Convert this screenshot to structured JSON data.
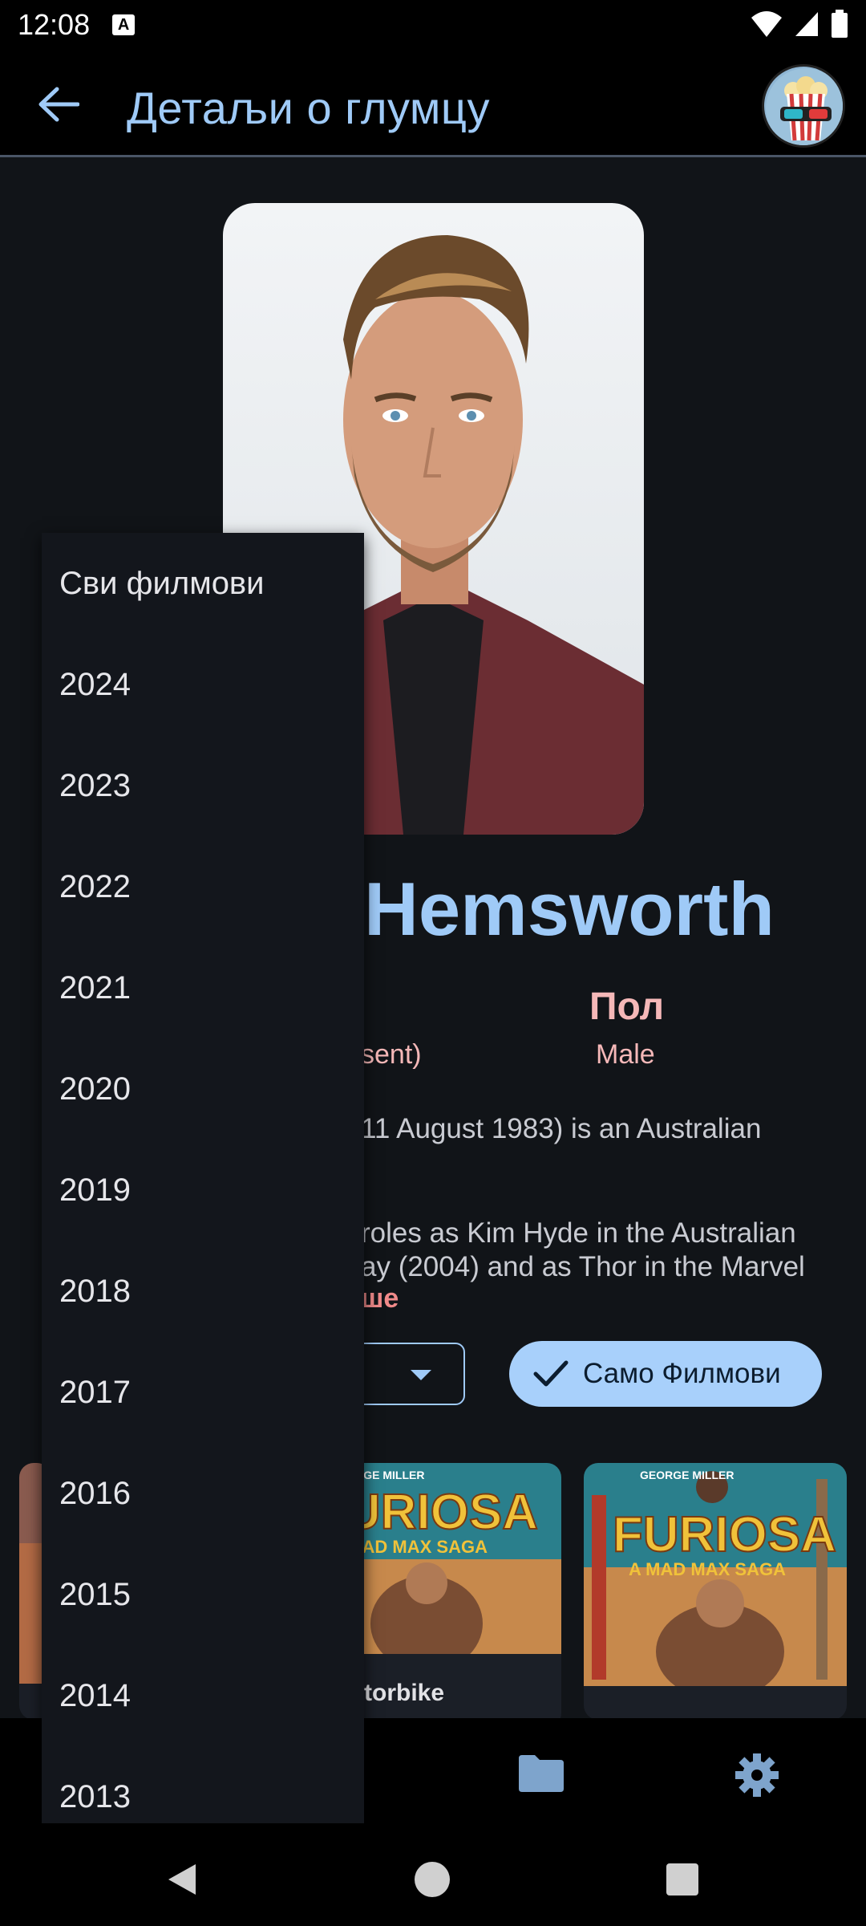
{
  "status_bar": {
    "time": "12:08",
    "notification_letter": "A"
  },
  "app_bar": {
    "title": "Детаљи о глумцу"
  },
  "actor": {
    "name_visible": "Hemsworth",
    "birth_value": "sent)",
    "gender_label": "Пол",
    "gender_value": "Male",
    "bio_lines": [
      "11 August 1983) is an Australian",
      "roles as Kim Hyde in the Australian",
      "ay (2004) and as Thor in the Marvel"
    ],
    "show_more": "ше"
  },
  "filters": {
    "chip_label": "Само Филмови"
  },
  "movies": [
    {
      "poster_title": "FURIOSA",
      "poster_subtitle": "A MAD MAX SAGA",
      "poster_credit": "GEORGE MILLER",
      "caption_line1": "torbike"
    },
    {
      "poster_title": "FURIOSA",
      "poster_subtitle": "A MAD MAX SAGA",
      "poster_credit": "GEORGE MILLER"
    }
  ],
  "year_menu": {
    "items": [
      "Сви филмови",
      "2024",
      "2023",
      "2022",
      "2021",
      "2020",
      "2019",
      "2018",
      "2017",
      "2016",
      "2015",
      "2014",
      "2013"
    ]
  },
  "bottom_nav": {
    "icons": [
      "folder-icon",
      "gear-icon"
    ]
  },
  "colors": {
    "accent": "#9fcaf7",
    "pink": "#f5b8b8",
    "chip": "#a8d0fb",
    "background": "#111418"
  }
}
